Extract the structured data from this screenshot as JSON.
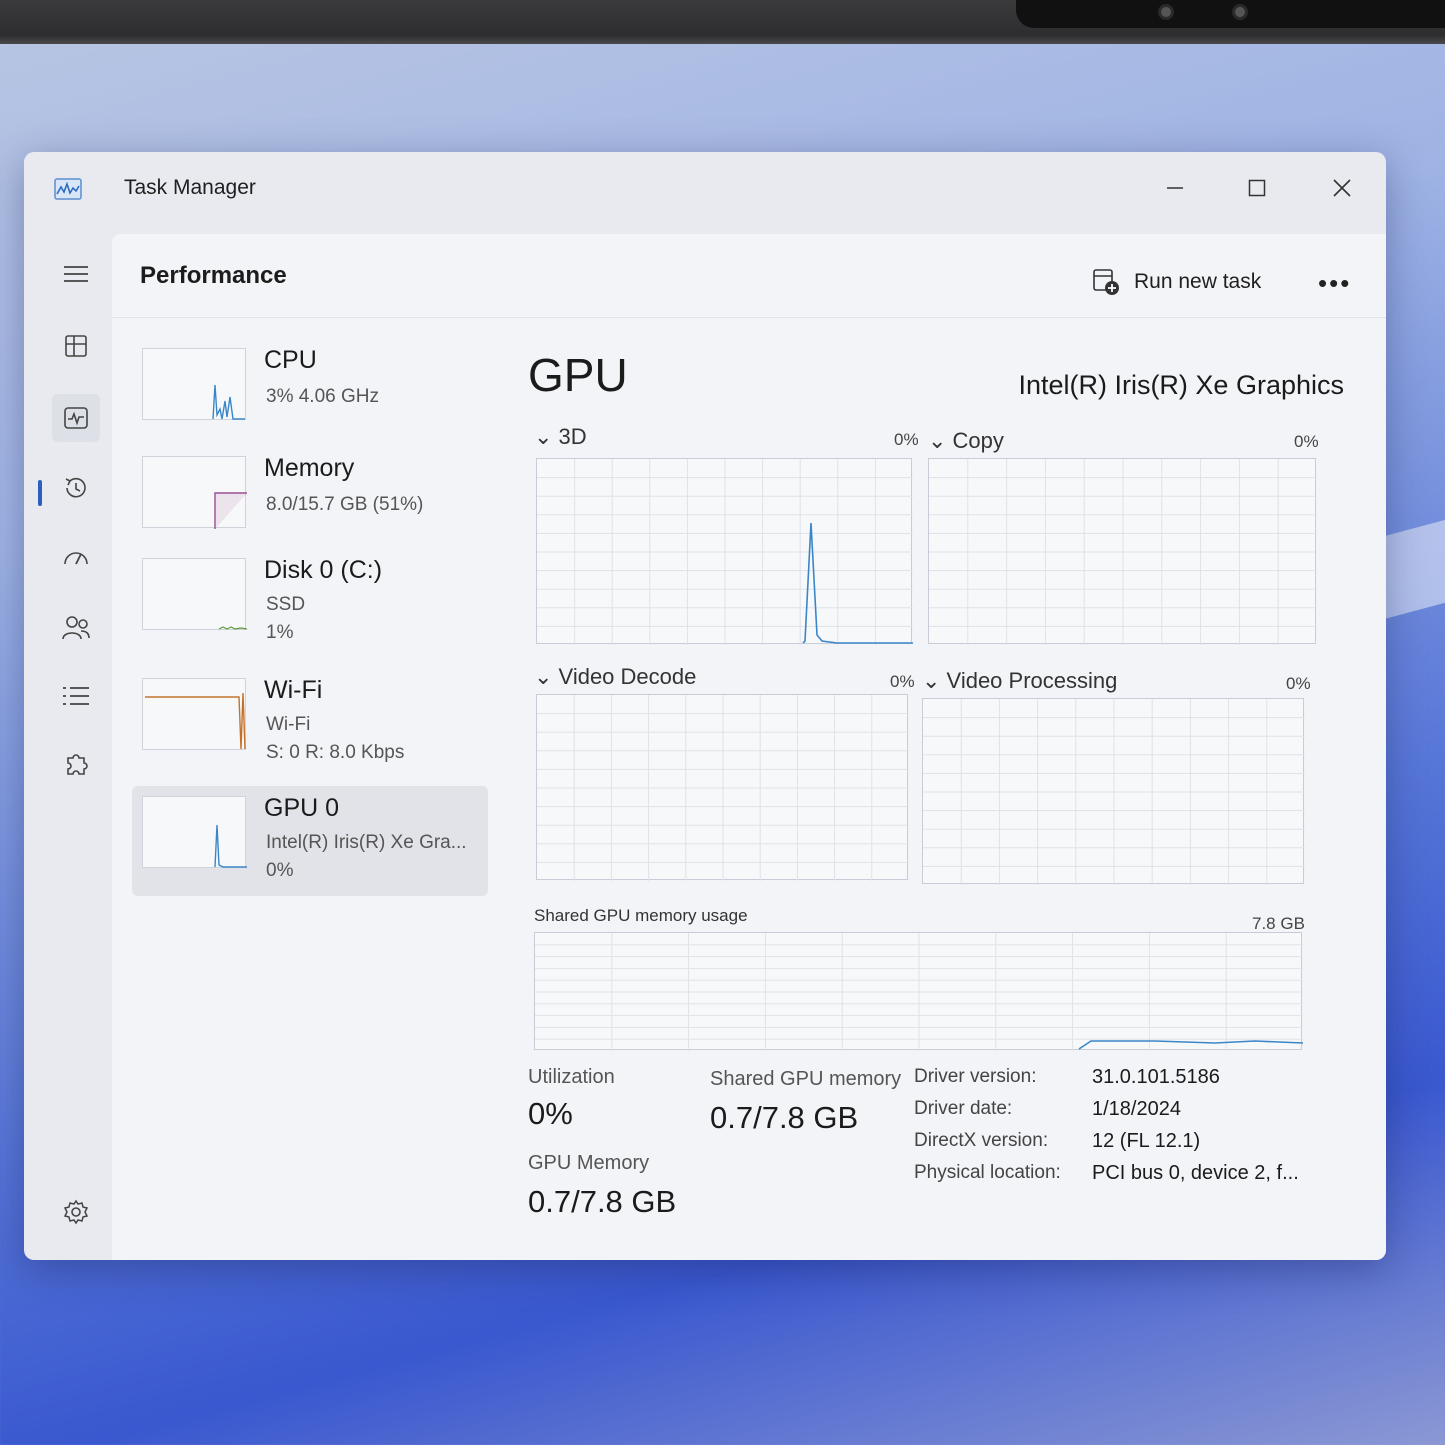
{
  "window": {
    "title": "Task Manager"
  },
  "header": {
    "page_title": "Performance",
    "run_new_task": "Run new task",
    "more": "•••"
  },
  "nav": {
    "items": [
      "menu",
      "processes",
      "performance",
      "app-history",
      "startup-apps",
      "users",
      "details",
      "services"
    ],
    "active": "performance"
  },
  "devices": [
    {
      "name": "CPU",
      "line1": "3% 4.06 GHz",
      "line2": ""
    },
    {
      "name": "Memory",
      "line1": "8.0/15.7 GB (51%)",
      "line2": ""
    },
    {
      "name": "Disk 0 (C:)",
      "line1": "SSD",
      "line2": "1%"
    },
    {
      "name": "Wi-Fi",
      "line1": "Wi-Fi",
      "line2": "S: 0 R: 8.0 Kbps"
    },
    {
      "name": "GPU 0",
      "line1": "Intel(R) Iris(R) Xe Gra...",
      "line2": "0%"
    }
  ],
  "main": {
    "title": "GPU",
    "device_name": "Intel(R) Iris(R) Xe Graphics",
    "engines": [
      {
        "label": "3D",
        "pct": "0%"
      },
      {
        "label": "Copy",
        "pct": "0%"
      },
      {
        "label": "Video Decode",
        "pct": "0%"
      },
      {
        "label": "Video Processing",
        "pct": "0%"
      }
    ],
    "shared_usage": {
      "label": "Shared GPU memory usage",
      "max": "7.8 GB"
    },
    "stats": {
      "utilization_label": "Utilization",
      "utilization_value": "0%",
      "shared_label": "Shared GPU memory",
      "shared_value": "0.7/7.8 GB",
      "gpu_mem_label": "GPU Memory",
      "gpu_mem_value": "0.7/7.8 GB"
    },
    "info": [
      {
        "label": "Driver version:",
        "value": "31.0.101.5186"
      },
      {
        "label": "Driver date:",
        "value": "1/18/2024"
      },
      {
        "label": "DirectX version:",
        "value": "12 (FL 12.1)"
      },
      {
        "label": "Physical location:",
        "value": "PCI bus 0, device 2, f..."
      }
    ]
  },
  "colors": {
    "accent": "#2d5fbf",
    "cpu_line": "#3a86c8",
    "memory_line": "#9b4f96",
    "wifi_line": "#c4722b",
    "gpu_line": "#3a86c8"
  }
}
